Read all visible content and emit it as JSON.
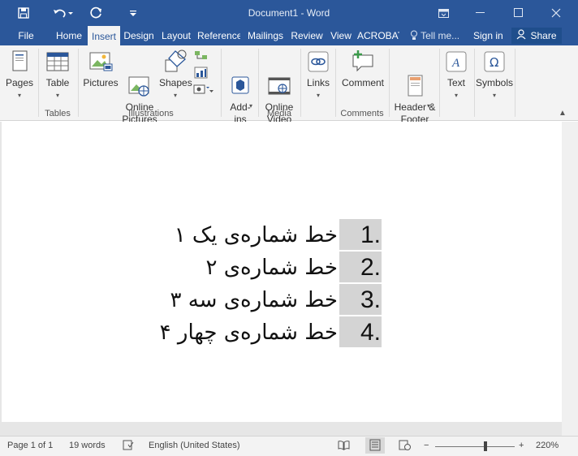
{
  "title_bar": {
    "title": "Document1 - Word",
    "background": "#2b579a"
  },
  "quick_access": {
    "save_icon": "save-icon",
    "undo_icon": "undo-icon",
    "redo_icon": "redo-icon",
    "customize_icon": "customize-qat-icon"
  },
  "tabs": [
    {
      "label": "File"
    },
    {
      "label": "Home"
    },
    {
      "label": "Insert",
      "active": true
    },
    {
      "label": "Design"
    },
    {
      "label": "Layout"
    },
    {
      "label": "References"
    },
    {
      "label": "Mailings"
    },
    {
      "label": "Review"
    },
    {
      "label": "View"
    },
    {
      "label": "ACROBAT"
    }
  ],
  "tell_me": "Tell me...",
  "sign_in": "Sign in",
  "share": "Share",
  "ribbon": {
    "pages": {
      "label": "Pages"
    },
    "table": {
      "label": "Table"
    },
    "tables_group": "Tables",
    "pictures": {
      "label": "Pictures"
    },
    "online_pictures": {
      "label": "Online\nPictures"
    },
    "shapes": {
      "label": "Shapes"
    },
    "illustrations_group": "Illustrations",
    "addins": {
      "label": "Add-\nins"
    },
    "online_video": {
      "label": "Online\nVideo"
    },
    "media_group": "Media",
    "links": {
      "label": "Links"
    },
    "comment": {
      "label": "Comment"
    },
    "comments_group": "Comments",
    "header_footer": {
      "label": "Header &\nFooter"
    },
    "text": {
      "label": "Text"
    },
    "symbols": {
      "label": "Symbols"
    }
  },
  "document": {
    "lines": [
      {
        "number": "1.",
        "text": "خط شماره‌ی یک ۱"
      },
      {
        "number": "2.",
        "text": "خط شماره‌ی ۲"
      },
      {
        "number": "3.",
        "text": "خط شماره‌ی سه ۳"
      },
      {
        "number": "4.",
        "text": "خط شماره‌ی چهار ۴"
      }
    ],
    "number_shading": "#d4d4d4"
  },
  "status_bar": {
    "page": "Page 1 of 1",
    "words": "19 words",
    "language": "English (United States)",
    "zoom": "220%",
    "zoom_minus": "−",
    "zoom_plus": "+"
  }
}
